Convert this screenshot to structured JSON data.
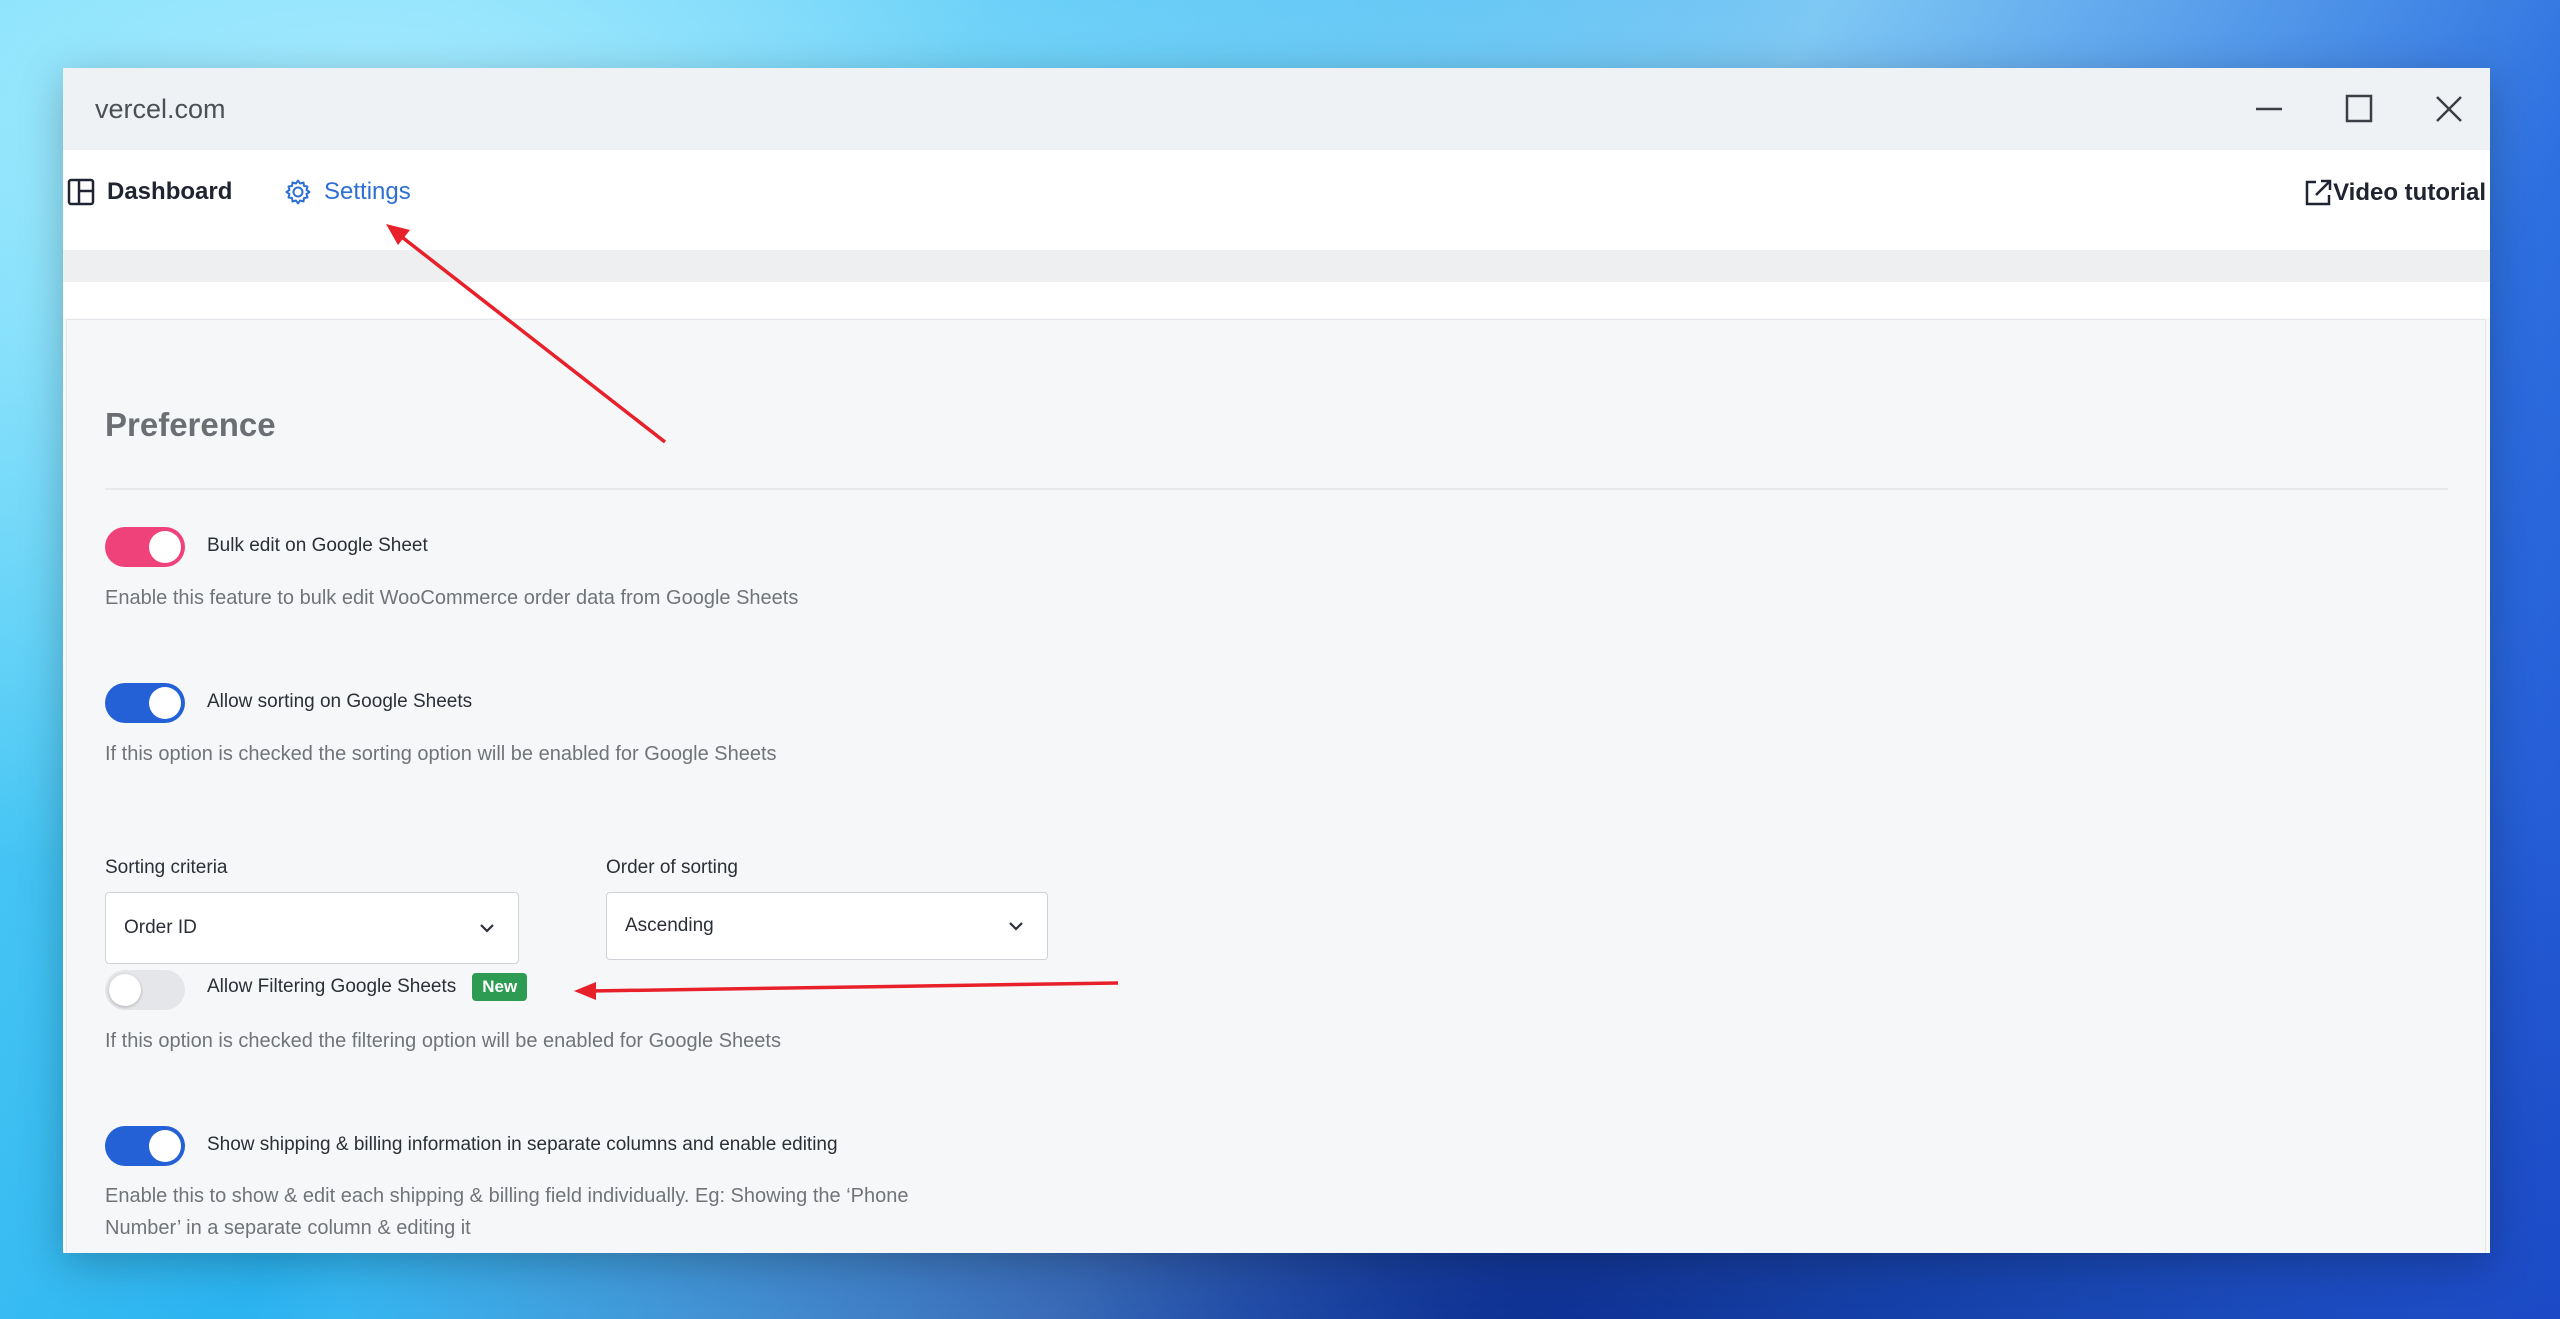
{
  "window": {
    "title": "vercel.com"
  },
  "nav": {
    "dashboard_label": "Dashboard",
    "settings_label": "Settings",
    "video_label": "Video tutorial"
  },
  "page": {
    "section_title": "Preference",
    "options": [
      {
        "label": "Bulk edit on Google Sheet",
        "description": "Enable this feature to bulk edit WooCommerce order data from Google Sheets",
        "enabled": true
      },
      {
        "label": "Allow sorting on Google Sheets",
        "description": "If this option is checked the sorting option will be enabled for Google Sheets",
        "enabled": true
      },
      {
        "label": "Allow Filtering Google Sheets",
        "badge": "New",
        "description": "If this option is checked the filtering option will be enabled for Google Sheets",
        "enabled": false
      },
      {
        "label": "Show shipping & billing information in separate columns and enable editing",
        "description_line1": "Enable this to show & edit each shipping & billing field individually. Eg: Showing the ‘Phone",
        "description_line2": "Number’ in a separate column & editing it",
        "enabled": true
      }
    ],
    "sorting": {
      "criteria_label": "Sorting criteria",
      "criteria_value": "Order ID",
      "order_label": "Order of sorting",
      "order_value": "Ascending"
    }
  },
  "colors": {
    "toggle_pink": "#f0427a",
    "toggle_blue": "#2561d6",
    "toggle_off": "#e5e6e9",
    "badge_green": "#2e9b52",
    "link_blue": "#2e6fd3",
    "annotation_red": "#e8202a"
  },
  "icons": {
    "dashboard": "layout-panel-icon",
    "settings": "gear-icon",
    "video": "external-link-icon",
    "minimize": "minimize-icon",
    "maximize": "maximize-icon",
    "close": "close-icon",
    "chevron": "chevron-down-icon"
  }
}
